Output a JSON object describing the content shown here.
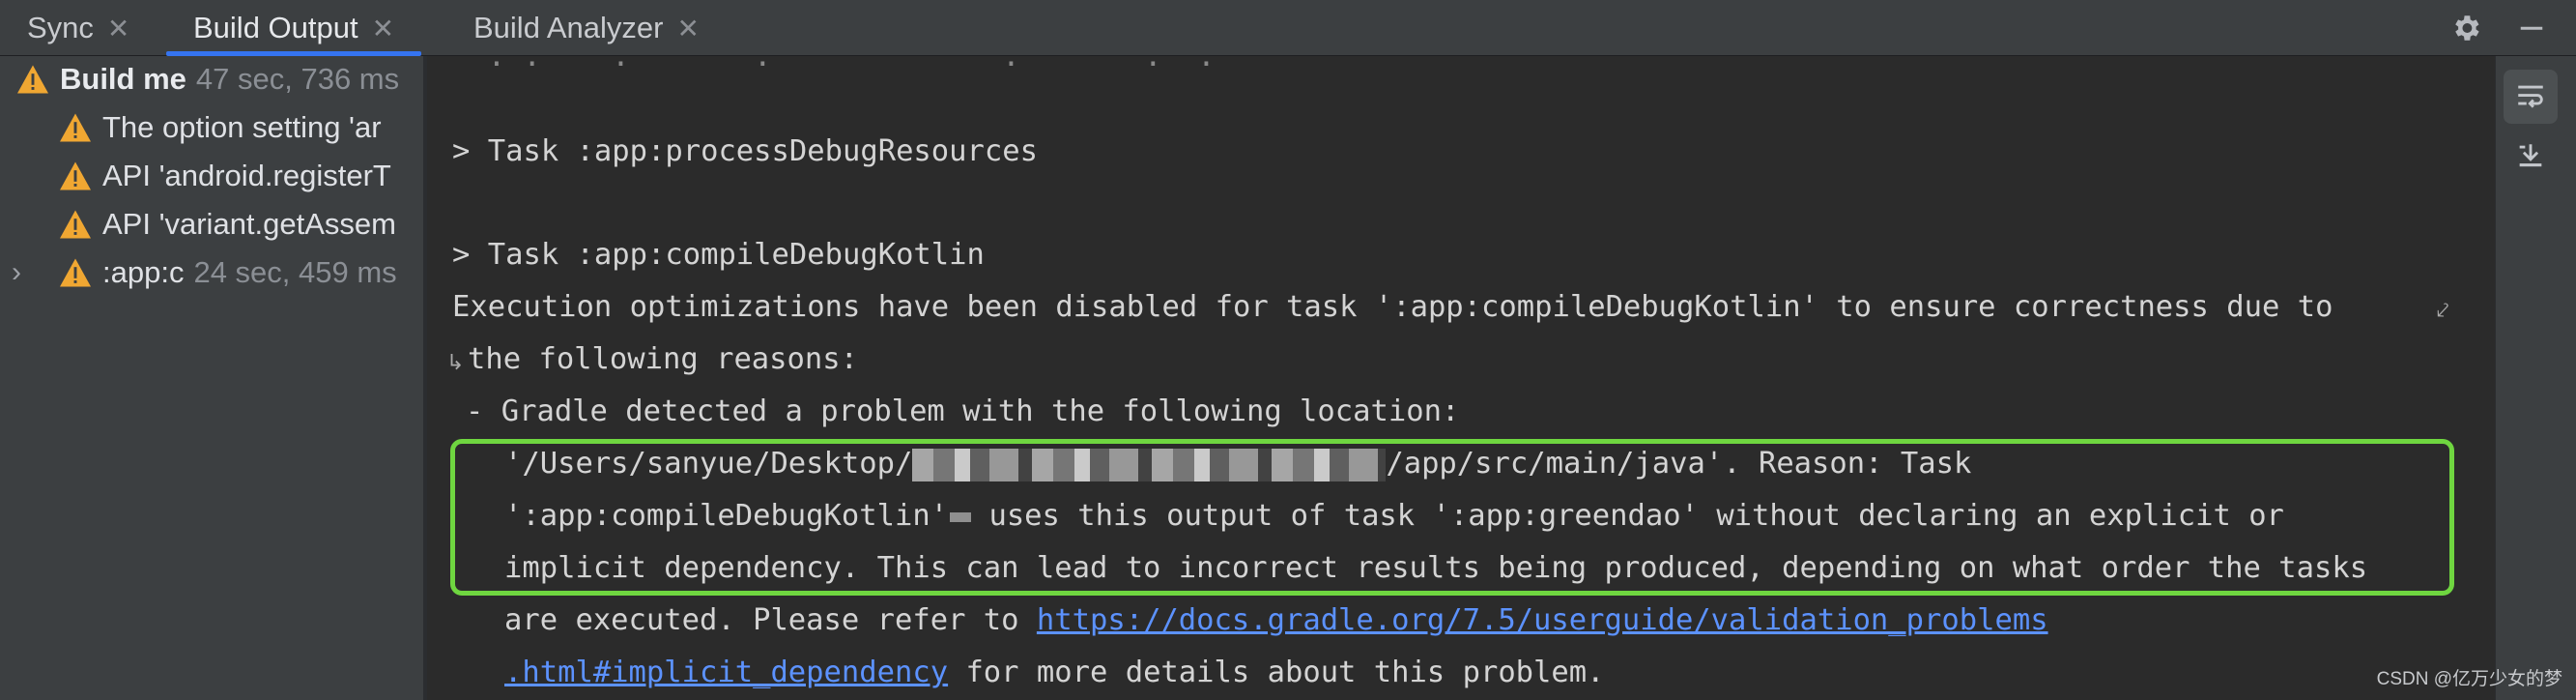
{
  "tabs": [
    {
      "label": "Sync",
      "active": false
    },
    {
      "label": "Build Output",
      "active": true
    },
    {
      "label": "Build Analyzer",
      "active": false
    }
  ],
  "toolbar": {
    "settings_icon": "gear-icon",
    "minimize_icon": "minimize-icon"
  },
  "tree": {
    "root": {
      "label": "Build me",
      "time": "47 sec, 736 ms"
    },
    "items": [
      {
        "label": "The option setting 'ar"
      },
      {
        "label": "API 'android.registerT"
      },
      {
        "label": "API 'variant.getAssem"
      }
    ],
    "task": {
      "label": ":app:c",
      "time": "24 sec, 459 ms"
    }
  },
  "console": {
    "lines": [
      "> Task :app:processDebugResources",
      "> Task :app:compileDebugKotlin",
      "Execution optimizations have been disabled for task ':app:compileDebugKotlin' to ensure correctness due to",
      "the following reasons:",
      "- Gradle detected a problem with the following location:",
      "'/Users/sanyue/Desktop/",
      "/app/src/main/java'. Reason: Task",
      "':app:compileDebugKotlin'",
      "uses this output of task ':app:greendao' without declaring an explicit or",
      "implicit dependency. This can lead to incorrect results being produced, depending on what order the tasks",
      "are executed. Please refer to ",
      "https://docs.gradle.org/7.5/userguide/validation_problems",
      ".html#implicit_dependency",
      " for more details about this problem."
    ]
  },
  "side_tools": [
    "soft-wrap-icon",
    "scroll-to-end-icon"
  ],
  "watermark": "CSDN @亿万少女的梦",
  "colors": {
    "accent": "#3574f0",
    "highlight": "#6fd640",
    "warning": "#f0a732",
    "link": "#5c92ff"
  }
}
